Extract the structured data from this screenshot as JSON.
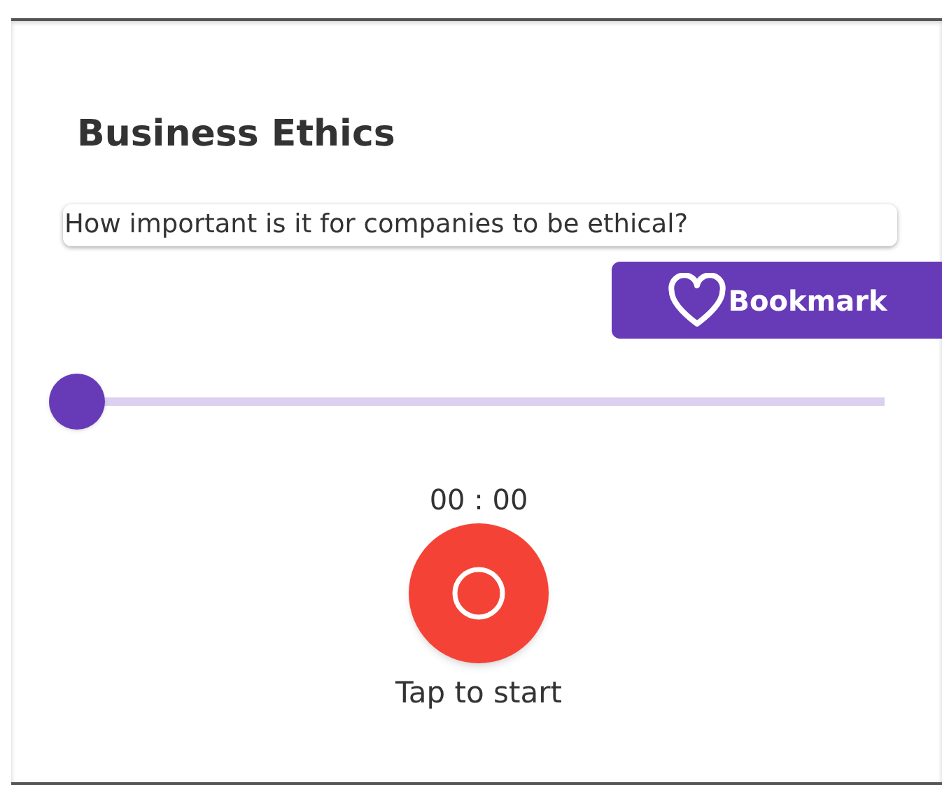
{
  "title": "Business Ethics",
  "question": "How important is it for companies to be ethical?",
  "bookmark_button": {
    "label": "Bookmark"
  },
  "slider": {
    "level": 0
  },
  "timer": "00 : 00",
  "record_button": {
    "recording": false
  },
  "hint": "Tap to start"
}
